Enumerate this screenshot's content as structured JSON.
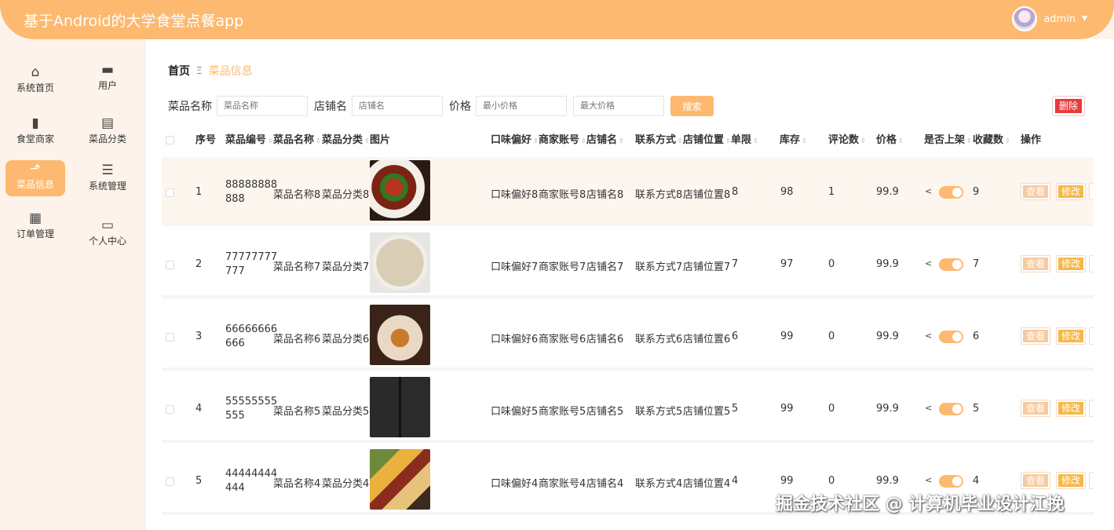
{
  "app": {
    "title": "基于Android的大学食堂点餐app",
    "user": "admin"
  },
  "sidebar": {
    "items": [
      {
        "label": "系统首页",
        "icon": "home-icon"
      },
      {
        "label": "用户",
        "icon": "user-icon"
      },
      {
        "label": "食堂商家",
        "icon": "shop-icon"
      },
      {
        "label": "菜品分类",
        "icon": "category-icon"
      },
      {
        "label": "菜品信息",
        "icon": "chart-icon",
        "active": true
      },
      {
        "label": "系统管理",
        "icon": "sliders-icon"
      },
      {
        "label": "订单管理",
        "icon": "grid-icon"
      },
      {
        "label": "个人中心",
        "icon": "card-icon"
      }
    ]
  },
  "breadcrumb": {
    "home": "首页",
    "separator": "Ξ",
    "current": "菜品信息"
  },
  "search": {
    "name_label": "菜品名称",
    "name_placeholder": "菜品名称",
    "shop_label": "店铺名",
    "shop_placeholder": "店铺名",
    "price_label": "价格",
    "min_placeholder": "最小价格",
    "max_placeholder": "最大价格",
    "search_button": "搜索",
    "delete_button": "删除"
  },
  "table": {
    "headers": {
      "index": "序号",
      "code": "菜品编号",
      "name": "菜品名称",
      "category": "菜品分类",
      "image": "图片",
      "taste": "口味偏好",
      "merchant": "商家账号",
      "shop": "店铺名",
      "contact": "联系方式",
      "location": "店铺位置",
      "limit": "单限",
      "stock": "库存",
      "comments": "评论数",
      "price": "价格",
      "onsale": "是否上架",
      "favorites": "收藏数",
      "actions": "操作"
    },
    "view_label": "查看",
    "edit_label": "修改",
    "rows": [
      {
        "index": "1",
        "code1": "88888888",
        "code2": "888",
        "name": "菜品名称8",
        "category": "菜品分类8",
        "taste": "口味偏好8",
        "merchant": "商家账号8",
        "shop": "店铺名8",
        "contact": "联系方式8",
        "location": "店铺位置8",
        "limit": "8",
        "stock": "98",
        "comments": "1",
        "price": "99.9",
        "favorites": "9"
      },
      {
        "index": "2",
        "code1": "77777777",
        "code2": "777",
        "name": "菜品名称7",
        "category": "菜品分类7",
        "taste": "口味偏好7",
        "merchant": "商家账号7",
        "shop": "店铺名7",
        "contact": "联系方式7",
        "location": "店铺位置7",
        "limit": "7",
        "stock": "97",
        "comments": "0",
        "price": "99.9",
        "favorites": "7"
      },
      {
        "index": "3",
        "code1": "66666666",
        "code2": "666",
        "name": "菜品名称6",
        "category": "菜品分类6",
        "taste": "口味偏好6",
        "merchant": "商家账号6",
        "shop": "店铺名6",
        "contact": "联系方式6",
        "location": "店铺位置6",
        "limit": "6",
        "stock": "99",
        "comments": "0",
        "price": "99.9",
        "favorites": "6"
      },
      {
        "index": "4",
        "code1": "55555555",
        "code2": "555",
        "name": "菜品名称5",
        "category": "菜品分类5",
        "taste": "口味偏好5",
        "merchant": "商家账号5",
        "shop": "店铺名5",
        "contact": "联系方式5",
        "location": "店铺位置5",
        "limit": "5",
        "stock": "99",
        "comments": "0",
        "price": "99.9",
        "favorites": "5"
      },
      {
        "index": "5",
        "code1": "44444444",
        "code2": "444",
        "name": "菜品名称4",
        "category": "菜品分类4",
        "taste": "口味偏好4",
        "merchant": "商家账号4",
        "shop": "店铺名4",
        "contact": "联系方式4",
        "location": "店铺位置4",
        "limit": "4",
        "stock": "99",
        "comments": "0",
        "price": "99.9",
        "favorites": "4"
      }
    ]
  },
  "watermark": "掘金技术社区 @ 计算机毕业设计江挽"
}
